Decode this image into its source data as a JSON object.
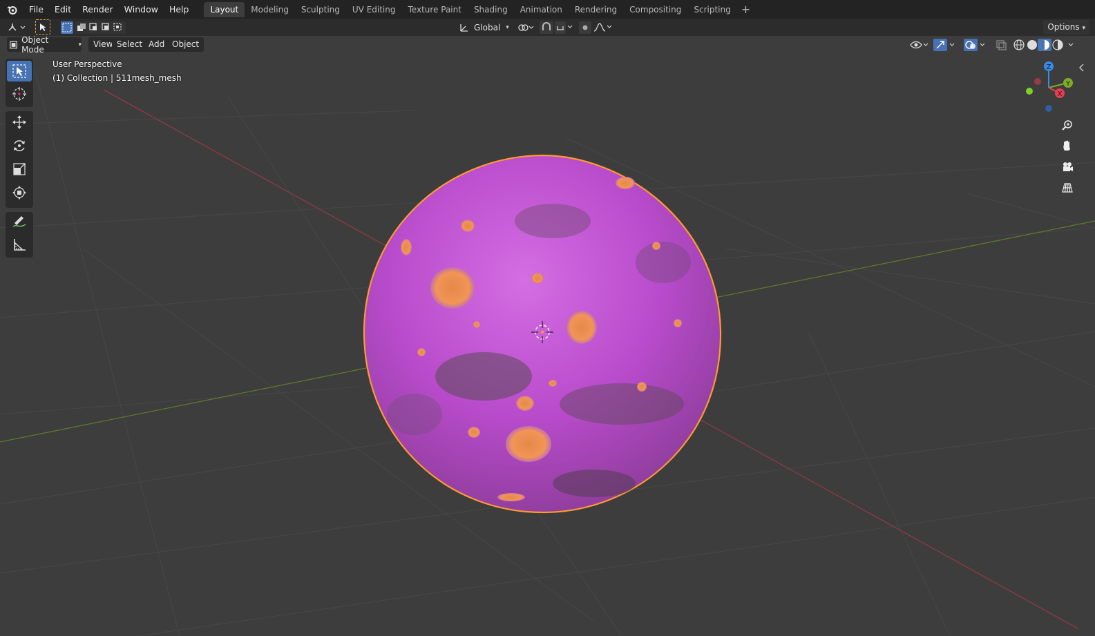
{
  "app": {
    "name": "Blender"
  },
  "topbar": {
    "menus": [
      "File",
      "Edit",
      "Render",
      "Window",
      "Help"
    ],
    "workspace_tabs": [
      "Layout",
      "Modeling",
      "Sculpting",
      "UV Editing",
      "Texture Paint",
      "Shading",
      "Animation",
      "Rendering",
      "Compositing",
      "Scripting"
    ],
    "active_tab": "Layout"
  },
  "tool_header": {
    "transform_orientation": "Global",
    "options_label": "Options"
  },
  "viewport_header": {
    "mode": "Object Mode",
    "menus": [
      "View",
      "Select",
      "Add",
      "Object"
    ]
  },
  "viewport": {
    "view_name": "User Perspective",
    "collection_info": "(1) Collection | 511mesh_mesh"
  },
  "gizmo": {
    "axes": [
      "Z",
      "Y",
      "X"
    ],
    "colors": {
      "x": "#e44052",
      "y": "#7fab2a",
      "z": "#3a8ae6"
    }
  },
  "colors": {
    "accent": "#4772b3",
    "selection_outline": "#ff9a2e",
    "planet": "#c04fd0"
  },
  "toolbar": {
    "tools": [
      "select-box",
      "cursor",
      "move",
      "rotate",
      "scale",
      "transform",
      "annotate",
      "measure"
    ],
    "active": "select-box"
  }
}
